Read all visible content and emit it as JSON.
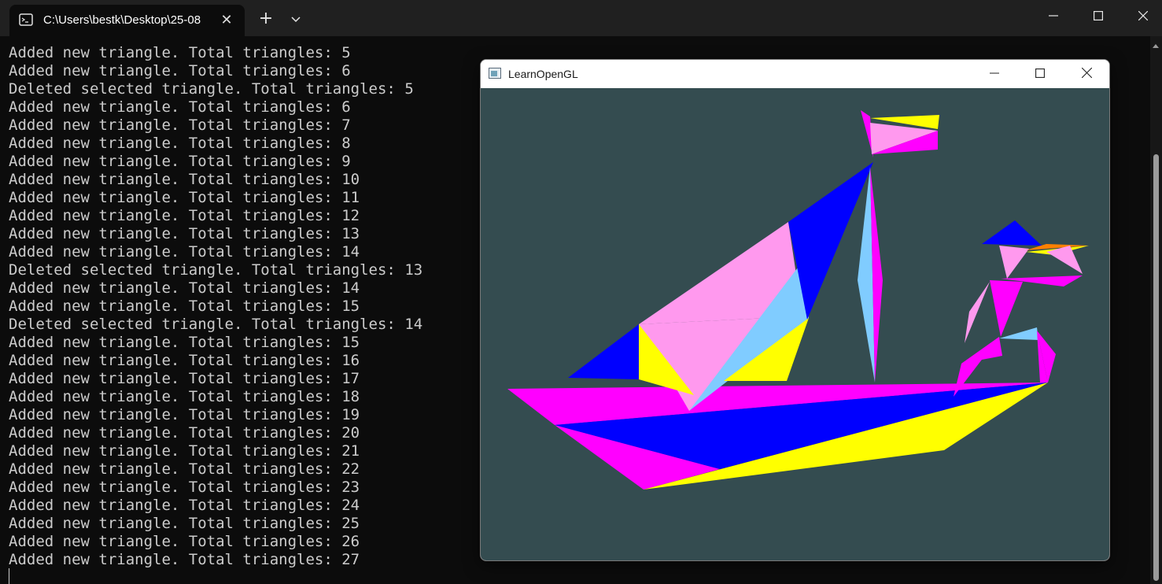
{
  "terminal": {
    "tab": {
      "title": "C:\\Users\\bestk\\Desktop\\25-08",
      "icon": "terminal-icon",
      "close_label": "✕"
    },
    "new_tab_label": "+",
    "dropdown_label": "⌄",
    "window_controls": {
      "minimize": "—",
      "maximize": "☐",
      "close": "✕"
    },
    "lines": [
      "Added new triangle. Total triangles: 5",
      "Added new triangle. Total triangles: 6",
      "Deleted selected triangle. Total triangles: 5",
      "Added new triangle. Total triangles: 6",
      "Added new triangle. Total triangles: 7",
      "Added new triangle. Total triangles: 8",
      "Added new triangle. Total triangles: 9",
      "Added new triangle. Total triangles: 10",
      "Added new triangle. Total triangles: 11",
      "Added new triangle. Total triangles: 12",
      "Added new triangle. Total triangles: 13",
      "Added new triangle. Total triangles: 14",
      "Deleted selected triangle. Total triangles: 13",
      "Added new triangle. Total triangles: 14",
      "Added new triangle. Total triangles: 15",
      "Deleted selected triangle. Total triangles: 14",
      "Added new triangle. Total triangles: 15",
      "Added new triangle. Total triangles: 16",
      "Added new triangle. Total triangles: 17",
      "Added new triangle. Total triangles: 18",
      "Added new triangle. Total triangles: 19",
      "Added new triangle. Total triangles: 20",
      "Added new triangle. Total triangles: 21",
      "Added new triangle. Total triangles: 22",
      "Added new triangle. Total triangles: 23",
      "Added new triangle. Total triangles: 24",
      "Added new triangle. Total triangles: 25",
      "Added new triangle. Total triangles: 26",
      "Added new triangle. Total triangles: 27"
    ]
  },
  "gl_window": {
    "title": "LearnOpenGL",
    "window_controls": {
      "minimize": "—",
      "maximize": "☐",
      "close": "✕"
    },
    "background_color": "#344c50",
    "palette": {
      "magenta": "#ff00ff",
      "blue": "#0000ff",
      "yellow": "#ffff00",
      "pink": "#ff99ee",
      "light_blue": "#80ccff",
      "orange": "#ff8000"
    }
  }
}
